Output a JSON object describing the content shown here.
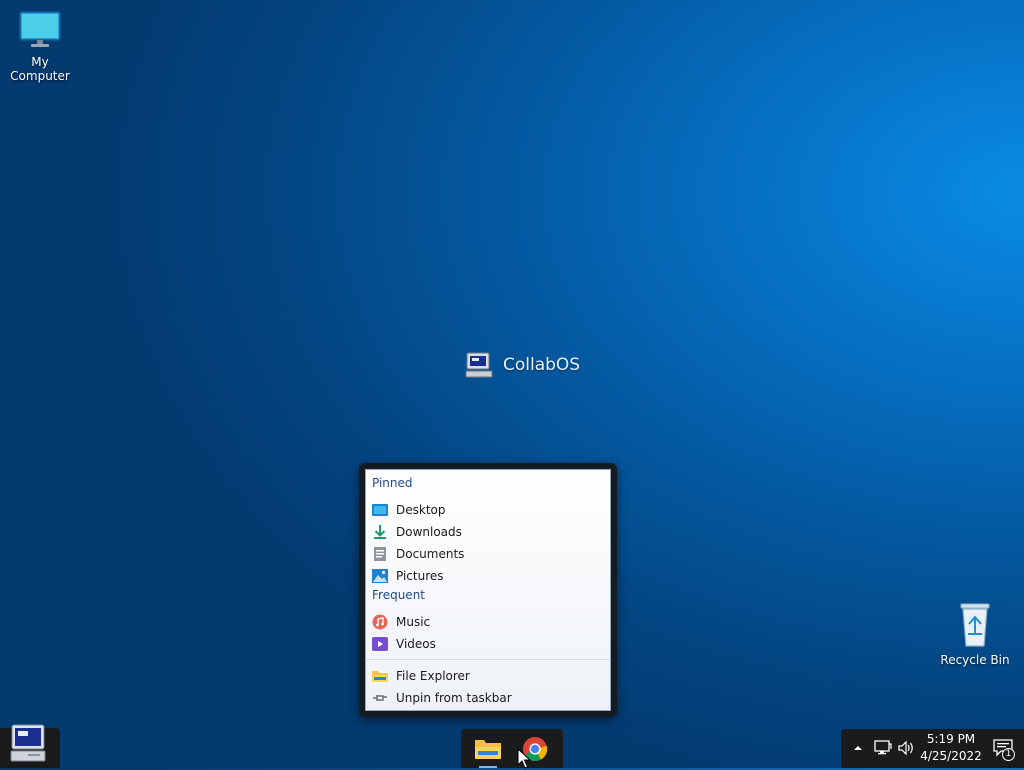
{
  "desktop": {
    "icons": [
      {
        "label": "My Computer"
      },
      {
        "label": "Recycle Bin"
      }
    ],
    "center_logo": {
      "text": "CollabOS"
    }
  },
  "jumplist": {
    "pinned_title": "Pinned",
    "pinned": [
      {
        "label": "Desktop",
        "icon": "desktop-folder-icon"
      },
      {
        "label": "Downloads",
        "icon": "downloads-icon"
      },
      {
        "label": "Documents",
        "icon": "documents-icon"
      },
      {
        "label": "Pictures",
        "icon": "pictures-icon"
      }
    ],
    "frequent_title": "Frequent",
    "frequent": [
      {
        "label": "Music",
        "icon": "music-icon"
      },
      {
        "label": "Videos",
        "icon": "videos-icon"
      }
    ],
    "tasks": [
      {
        "label": "File Explorer",
        "icon": "file-explorer-icon"
      },
      {
        "label": "Unpin from taskbar",
        "icon": "unpin-icon"
      }
    ]
  },
  "taskbar": {
    "apps": [
      {
        "name": "File Explorer",
        "icon": "folder-icon"
      },
      {
        "name": "Chrome",
        "icon": "chrome-icon"
      }
    ],
    "tray": {
      "time": "5:19 PM",
      "date": "4/25/2022",
      "notifications": "1"
    }
  },
  "colors": {
    "accent": "#0a8be4",
    "taskbar": "#1b1b1b"
  }
}
